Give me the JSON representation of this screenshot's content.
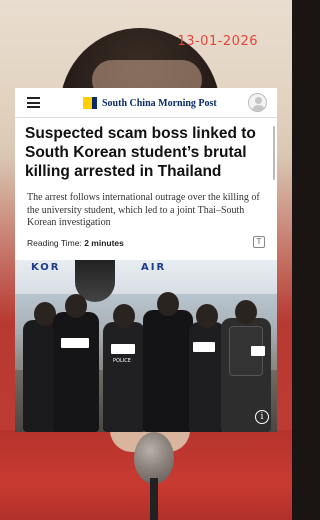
{
  "overlay": {
    "date": "13-01-2026"
  },
  "header": {
    "brand_name": "South China Morning Post",
    "menu_icon": "hamburger-menu-icon",
    "avatar_icon": "user-avatar-icon",
    "logo_colors": {
      "yellow": "#ffcf00",
      "navy": "#0a2a6a"
    }
  },
  "article": {
    "headline": "Suspected scam boss linked to South Korean student’s brutal killing arrested in Thailand",
    "summary": "The arrest follows international outrage over the killing of the university student, which led to a joint Thai–South Korean investigation",
    "reading_time_label": "Reading Time:",
    "reading_time_value": "2 minutes",
    "font_size_icon": "font-size-icon"
  },
  "photo": {
    "aircraft_text_left": "KOR",
    "aircraft_text_right": "AIR",
    "vest_label": "POLICE",
    "info_icon": "info-icon"
  },
  "colors": {
    "date_red": "#e5453c",
    "headline": "#111111"
  }
}
